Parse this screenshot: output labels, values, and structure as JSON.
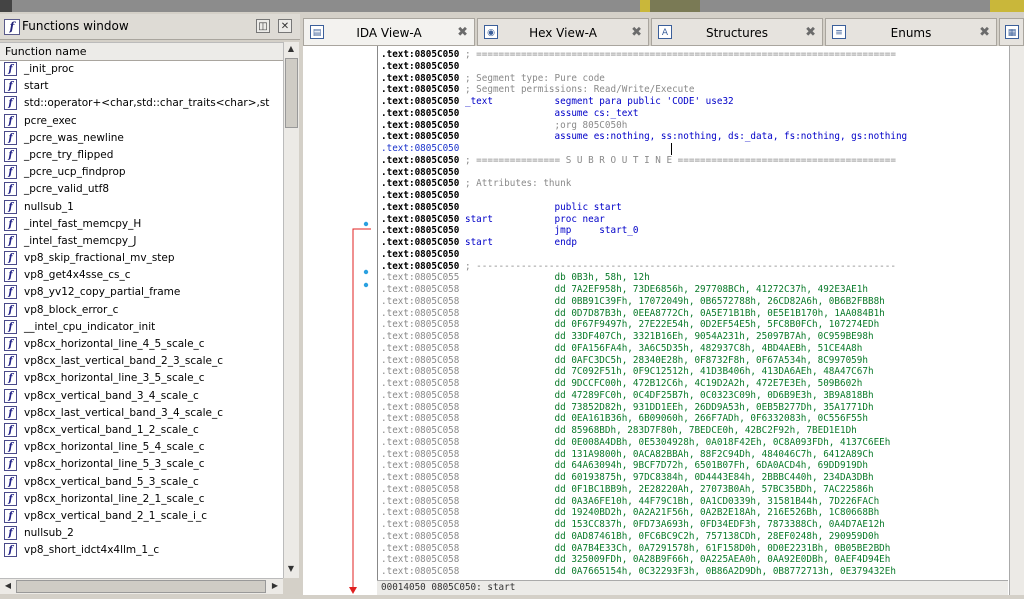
{
  "functions_window": {
    "title": "Functions window",
    "column_header": "Function name",
    "items": [
      "_init_proc",
      "start",
      "std::operator+<char,std::char_traits<char>,st",
      "pcre_exec",
      "_pcre_was_newline",
      "_pcre_try_flipped",
      "_pcre_ucp_findprop",
      "_pcre_valid_utf8",
      "nullsub_1",
      "_intel_fast_memcpy_H",
      "_intel_fast_memcpy_J",
      "vp8_skip_fractional_mv_step",
      "vp8_get4x4sse_cs_c",
      "vp8_yv12_copy_partial_frame",
      "vp8_block_error_c",
      "__intel_cpu_indicator_init",
      "vp8cx_horizontal_line_4_5_scale_c",
      "vp8cx_last_vertical_band_2_3_scale_c",
      "vp8cx_horizontal_line_3_5_scale_c",
      "vp8cx_vertical_band_3_4_scale_c",
      "vp8cx_last_vertical_band_3_4_scale_c",
      "vp8cx_vertical_band_1_2_scale_c",
      "vp8cx_horizontal_line_5_4_scale_c",
      "vp8cx_horizontal_line_5_3_scale_c",
      "vp8cx_vertical_band_5_3_scale_c",
      "vp8cx_horizontal_line_2_1_scale_c",
      "vp8cx_vertical_band_2_1_scale_i_c",
      "nullsub_2",
      "vp8_short_idct4x4llm_1_c"
    ]
  },
  "tabs": [
    {
      "label": "IDA View-A",
      "icon": "disassembly-icon",
      "active": true
    },
    {
      "label": "Hex View-A",
      "icon": "hex-icon",
      "active": false
    },
    {
      "label": "Structures",
      "icon": "structures-icon",
      "active": false
    },
    {
      "label": "Enums",
      "icon": "enums-icon",
      "active": false
    }
  ],
  "disassembly": [
    {
      "addr": ".text:0805C050",
      "s": "addr",
      "parts": [
        {
          "c": "cm",
          "t": " ; ==========================================================================="
        }
      ]
    },
    {
      "addr": ".text:0805C050",
      "s": "addr",
      "parts": []
    },
    {
      "addr": ".text:0805C050",
      "s": "addr",
      "parts": [
        {
          "c": "cm",
          "t": " ; Segment type: Pure code"
        }
      ]
    },
    {
      "addr": ".text:0805C050",
      "s": "addr",
      "parts": [
        {
          "c": "cm",
          "t": " ; Segment permissions: Read/Write/Execute"
        }
      ]
    },
    {
      "addr": ".text:0805C050",
      "s": "addr",
      "parts": [
        {
          "c": "kw",
          "t": " _text           segment para public 'CODE' use32"
        }
      ]
    },
    {
      "addr": ".text:0805C050",
      "s": "addr",
      "parts": [
        {
          "c": "kw",
          "t": "                 assume cs:_text"
        }
      ]
    },
    {
      "addr": ".text:0805C050",
      "s": "addr",
      "parts": [
        {
          "c": "cm",
          "t": "                 ;org 805C050h"
        }
      ]
    },
    {
      "addr": ".text:0805C050",
      "s": "addr",
      "parts": [
        {
          "c": "kw",
          "t": "                 assume es:nothing, ss:nothing, ds:_data, fs:nothing, gs:nothing"
        }
      ]
    },
    {
      "addr": ".text:0805C050",
      "s": "blue",
      "parts": []
    },
    {
      "addr": ".text:0805C050",
      "s": "addr",
      "parts": [
        {
          "c": "cm",
          "t": " ; =============== S U B R O U T I N E ======================================="
        }
      ]
    },
    {
      "addr": ".text:0805C050",
      "s": "addr",
      "parts": []
    },
    {
      "addr": ".text:0805C050",
      "s": "addr",
      "parts": [
        {
          "c": "cm",
          "t": " ; Attributes: thunk"
        }
      ]
    },
    {
      "addr": ".text:0805C050",
      "s": "addr",
      "parts": []
    },
    {
      "addr": ".text:0805C050",
      "s": "addr",
      "parts": [
        {
          "c": "kw",
          "t": "                 public start"
        }
      ]
    },
    {
      "addr": ".text:0805C050",
      "s": "addr",
      "parts": [
        {
          "c": "kw",
          "t": " start           proc near"
        }
      ]
    },
    {
      "addr": ".text:0805C050",
      "s": "addr",
      "parts": [
        {
          "c": "kw",
          "t": "                 jmp     start_0"
        }
      ]
    },
    {
      "addr": ".text:0805C050",
      "s": "addr",
      "parts": [
        {
          "c": "kw",
          "t": " start           endp"
        }
      ]
    },
    {
      "addr": ".text:0805C050",
      "s": "addr",
      "parts": []
    },
    {
      "addr": ".text:0805C050",
      "s": "addr",
      "parts": [
        {
          "c": "cm",
          "t": " ; ---------------------------------------------------------------------------"
        }
      ]
    },
    {
      "addr": ".text:0805C055",
      "s": "gray",
      "parts": [
        {
          "c": "dt",
          "t": "                 db 0B3h, 58h, 12h"
        }
      ]
    },
    {
      "addr": ".text:0805C058",
      "s": "gray",
      "parts": [
        {
          "c": "dt",
          "t": "                 dd 7A2EF958h, 73DE6856h, 297708BCh, 41272C37h, 492E3AE1h"
        }
      ]
    },
    {
      "addr": ".text:0805C058",
      "s": "gray",
      "parts": [
        {
          "c": "dt",
          "t": "                 dd 0BB91C39Fh, 17072049h, 0B6572788h, 26CD82A6h, 0B6B2FBB8h"
        }
      ]
    },
    {
      "addr": ".text:0805C058",
      "s": "gray",
      "parts": [
        {
          "c": "dt",
          "t": "                 dd 0D7D87B3h, 0EEA8772Ch, 0A5E71B1Bh, 0E5E1B170h, 1AA084B1h"
        }
      ]
    },
    {
      "addr": ".text:0805C058",
      "s": "gray",
      "parts": [
        {
          "c": "dt",
          "t": "                 dd 0F67F9497h, 27E22E54h, 0D2EF54E5h, 5FC8B0FCh, 107274EDh"
        }
      ]
    },
    {
      "addr": ".text:0805C058",
      "s": "gray",
      "parts": [
        {
          "c": "dt",
          "t": "                 dd 33DF407Ch, 3321B16Eh, 9054A231h, 25097B7Ah, 0C959BE98h"
        }
      ]
    },
    {
      "addr": ".text:0805C058",
      "s": "gray",
      "parts": [
        {
          "c": "dt",
          "t": "                 dd 0FA156FA4h, 3A6C5D35h, 482937C8h, 4BD4AEBh, 51CE4A8h"
        }
      ]
    },
    {
      "addr": ".text:0805C058",
      "s": "gray",
      "parts": [
        {
          "c": "dt",
          "t": "                 dd 0AFC3DC5h, 28340E28h, 0F8732F8h, 0F67A534h, 8C997059h"
        }
      ]
    },
    {
      "addr": ".text:0805C058",
      "s": "gray",
      "parts": [
        {
          "c": "dt",
          "t": "                 dd 7C092F51h, 0F9C12512h, 41D3B406h, 413DA6AEh, 48A47C67h"
        }
      ]
    },
    {
      "addr": ".text:0805C058",
      "s": "gray",
      "parts": [
        {
          "c": "dt",
          "t": "                 dd 9DCCFC00h, 472B12C6h, 4C19D2A2h, 472E7E3Eh, 509B602h"
        }
      ]
    },
    {
      "addr": ".text:0805C058",
      "s": "gray",
      "parts": [
        {
          "c": "dt",
          "t": "                 dd 47289FC0h, 0C4DF25B7h, 0C0323C09h, 0D6B9E3h, 3B9A818Bh"
        }
      ]
    },
    {
      "addr": ".text:0805C058",
      "s": "gray",
      "parts": [
        {
          "c": "dt",
          "t": "                 dd 73852D82h, 931DD1EEh, 26DD9A53h, 0EB5B277Dh, 35A1771Dh"
        }
      ]
    },
    {
      "addr": ".text:0805C058",
      "s": "gray",
      "parts": [
        {
          "c": "dt",
          "t": "                 dd 0EA161B36h, 6B09060h, 266F7ADh, 0F6332083h, 0C556F55h"
        }
      ]
    },
    {
      "addr": ".text:0805C058",
      "s": "gray",
      "parts": [
        {
          "c": "dt",
          "t": "                 dd 85968BDh, 283D7F80h, 7BEDCE0h, 42BC2F92h, 7BED1E1Dh"
        }
      ]
    },
    {
      "addr": ".text:0805C058",
      "s": "gray",
      "parts": [
        {
          "c": "dt",
          "t": "                 dd 0E008A4DBh, 0E5304928h, 0A018F42Eh, 0C8A093FDh, 4137C6EEh"
        }
      ]
    },
    {
      "addr": ".text:0805C058",
      "s": "gray",
      "parts": [
        {
          "c": "dt",
          "t": "                 dd 131A9800h, 0ACA82BBAh, 88F2C94Dh, 484046C7h, 6412A89Ch"
        }
      ]
    },
    {
      "addr": ".text:0805C058",
      "s": "gray",
      "parts": [
        {
          "c": "dt",
          "t": "                 dd 64A63094h, 9BCF7D72h, 6501B07Fh, 6DA0ACD4h, 69DD919Dh"
        }
      ]
    },
    {
      "addr": ".text:0805C058",
      "s": "gray",
      "parts": [
        {
          "c": "dt",
          "t": "                 dd 60193875h, 97DC8384h, 0D4443E84h, 2BBBC440h, 234DA3DBh"
        }
      ]
    },
    {
      "addr": ".text:0805C058",
      "s": "gray",
      "parts": [
        {
          "c": "dt",
          "t": "                 dd 0F1BC1BB9h, 2E28220Ah, 27073B0Ah, 57BC35BDh, 7AC22586h"
        }
      ]
    },
    {
      "addr": ".text:0805C058",
      "s": "gray",
      "parts": [
        {
          "c": "dt",
          "t": "                 dd 0A3A6FE10h, 44F79C1Bh, 0A1CD0339h, 31581B44h, 7D226FACh"
        }
      ]
    },
    {
      "addr": ".text:0805C058",
      "s": "gray",
      "parts": [
        {
          "c": "dt",
          "t": "                 dd 19240BD2h, 0A2A21F56h, 0A2B2E18Ah, 216E526Bh, 1C80668Bh"
        }
      ]
    },
    {
      "addr": ".text:0805C058",
      "s": "gray",
      "parts": [
        {
          "c": "dt",
          "t": "                 dd 153CC837h, 0FD73A693h, 0FD34EDF3h, 7873388Ch, 0A4D7AE12h"
        }
      ]
    },
    {
      "addr": ".text:0805C058",
      "s": "gray",
      "parts": [
        {
          "c": "dt",
          "t": "                 dd 0AD87461Bh, 0FC6BC9C2h, 757138CDh, 28EF0248h, 290959D0h"
        }
      ]
    },
    {
      "addr": ".text:0805C058",
      "s": "gray",
      "parts": [
        {
          "c": "dt",
          "t": "                 dd 0A7B4E33Ch, 0A7291578h, 61F158D0h, 0D0E2231Bh, 0B05BE2BDh"
        }
      ]
    },
    {
      "addr": ".text:0805C058",
      "s": "gray",
      "parts": [
        {
          "c": "dt",
          "t": "                 dd 325009FDh, 0A28B9F66h, 0A225AEA0h, 0AA92E0DBh, 0AEF4D94Eh"
        }
      ]
    },
    {
      "addr": ".text:0805C058",
      "s": "gray",
      "parts": [
        {
          "c": "dt",
          "t": "                 dd 0A7665154h, 0C32293F3h, 0B86A2D9Dh, 0B8772713h, 0E379432Eh"
        }
      ]
    }
  ],
  "status_text": "00014050 0805C050: start",
  "colors": {
    "code_keyword": "#0000c8",
    "code_data": "#0a7a2a",
    "code_comment": "#8a8a8a",
    "jump_arrow": "#e02020"
  }
}
